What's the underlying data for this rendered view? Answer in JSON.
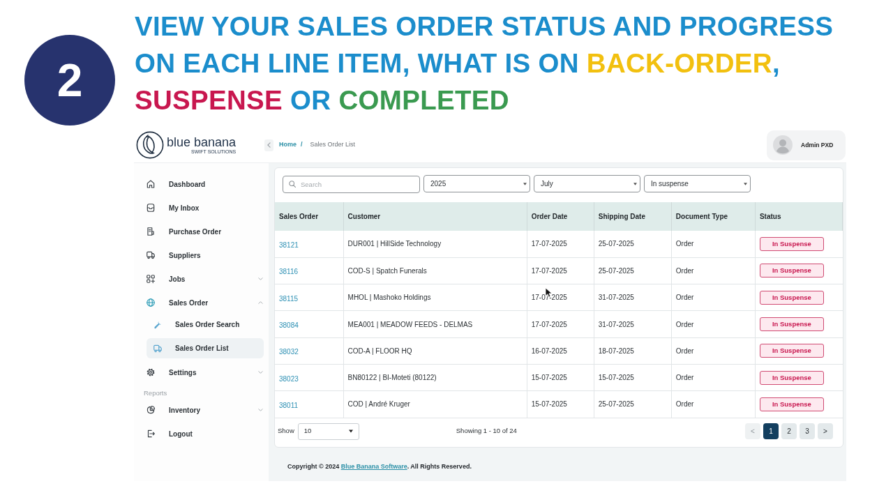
{
  "step": {
    "number": "2"
  },
  "headline": {
    "lines": [
      {
        "segments": [
          {
            "text": "VIEW YOUR SALES ORDER STATUS AND PROGRESS",
            "color": "#1b8dcc"
          }
        ]
      },
      {
        "segments": [
          {
            "text": "ON EACH LINE ITEM, WHAT IS ON ",
            "color": "#1b8dcc"
          },
          {
            "text": "BACK-ORDER",
            "color": "#f2c00f"
          },
          {
            "text": ",",
            "color": "#1b8dcc"
          }
        ]
      },
      {
        "segments": [
          {
            "text": "SUSPENSE",
            "color": "#c8174f"
          },
          {
            "text": " OR ",
            "color": "#1b8dcc"
          },
          {
            "text": "COMPLETED",
            "color": "#3a9a50"
          }
        ]
      }
    ]
  },
  "app": {
    "logo": {
      "name": "blue banana",
      "tagline": "SWIFT SOLUTIONS"
    },
    "breadcrumb": {
      "items": [
        {
          "label": "Home",
          "kind": "link"
        },
        {
          "label": "Sales Order List",
          "kind": "current"
        }
      ],
      "separator": "/"
    },
    "user": {
      "name": "Admin PXD"
    },
    "sidebar": {
      "items": [
        {
          "kind": "link",
          "label": "Dashboard",
          "selected": false
        },
        {
          "kind": "link",
          "label": "My Inbox",
          "selected": false
        },
        {
          "kind": "link",
          "label": "Purchase Order",
          "selected": false
        },
        {
          "kind": "link",
          "label": "Suppliers",
          "selected": false
        },
        {
          "kind": "group",
          "label": "Jobs",
          "selected": false,
          "expanded": false
        },
        {
          "kind": "group",
          "label": "Sales Order",
          "selected": true,
          "expanded": true,
          "children": [
            {
              "label": "Sales Order Search",
              "selected": false
            },
            {
              "label": "Sales Order List",
              "selected": true
            }
          ]
        },
        {
          "kind": "group",
          "label": "Settings",
          "selected": false,
          "expanded": false
        },
        {
          "kind": "section",
          "label": "Reports"
        },
        {
          "kind": "group",
          "label": "Inventory",
          "selected": false,
          "expanded": false
        },
        {
          "kind": "link",
          "label": "Logout",
          "selected": false
        }
      ]
    },
    "filters": {
      "search": {
        "placeholder": "Search"
      },
      "selects": [
        {
          "value": "2025"
        },
        {
          "value": "July"
        },
        {
          "value": "In suspense"
        }
      ]
    },
    "table": {
      "columns": [
        "Sales Order",
        "Customer",
        "Order Date",
        "Shipping Date",
        "Document Type",
        "Status"
      ],
      "rows": [
        [
          "38121",
          "DUR001 | HillSide Technology",
          "17-07-2025",
          "25-07-2025",
          "Order",
          "In Suspense"
        ],
        [
          "38116",
          "COD-S | Spatch Funerals",
          "17-07-2025",
          "25-07-2025",
          "Order",
          "In Suspense"
        ],
        [
          "38115",
          "MHOL | Mashoko Holdings",
          "17-07-2025",
          "31-07-2025",
          "Order",
          "In Suspense"
        ],
        [
          "38084",
          "MEA001 | MEADOW FEEDS - DELMAS",
          "17-07-2025",
          "31-07-2025",
          "Order",
          "In Suspense"
        ],
        [
          "38032",
          "COD-A | FLOOR HQ",
          "16-07-2025",
          "18-07-2025",
          "Order",
          "In Suspense"
        ],
        [
          "38023",
          "BN80122 | BI-Moteti (80122)",
          "15-07-2025",
          "15-07-2025",
          "Order",
          "In Suspense"
        ],
        [
          "38011",
          "COD | André Kruger",
          "15-07-2025",
          "25-07-2025",
          "Order",
          "In Suspense"
        ]
      ]
    },
    "pagination": {
      "show_label": "Show",
      "page_size": "10",
      "summary": "Showing 1 - 10 of 24",
      "buttons": [
        {
          "label": "<",
          "selected": false,
          "disabled": true
        },
        {
          "label": "1",
          "selected": true,
          "disabled": false
        },
        {
          "label": "2",
          "selected": false,
          "disabled": false
        },
        {
          "label": "3",
          "selected": false,
          "disabled": false
        },
        {
          "label": ">",
          "selected": false,
          "disabled": false
        }
      ]
    },
    "footer": {
      "text_before": "Copyright © 2024 ",
      "link": "Blue Banana Software",
      "text_after": ". All Rights Reserved."
    }
  }
}
